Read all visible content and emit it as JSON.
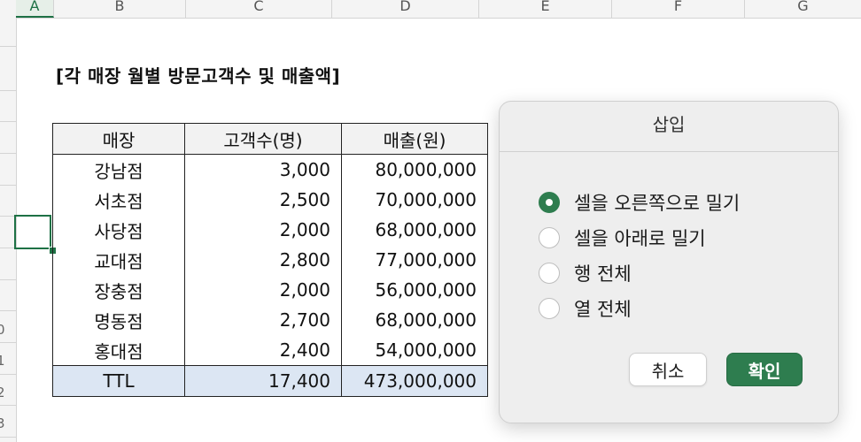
{
  "columns": [
    "A",
    "B",
    "C",
    "D",
    "E",
    "F",
    "G"
  ],
  "row_numbers": [
    "0",
    "1",
    "2",
    "3"
  ],
  "sheet": {
    "title": "[각 매장 월별 방문고객수 및 매출액]",
    "table": {
      "headers": [
        "매장",
        "고객수(명)",
        "매출(원)"
      ],
      "rows": [
        [
          "강남점",
          "3,000",
          "80,000,000"
        ],
        [
          "서초점",
          "2,500",
          "70,000,000"
        ],
        [
          "사당점",
          "2,000",
          "68,000,000"
        ],
        [
          "교대점",
          "2,800",
          "77,000,000"
        ],
        [
          "장충점",
          "2,000",
          "56,000,000"
        ],
        [
          "명동점",
          "2,700",
          "68,000,000"
        ],
        [
          "홍대점",
          "2,400",
          "54,000,000"
        ]
      ],
      "total": [
        "TTL",
        "17,400",
        "473,000,000"
      ]
    }
  },
  "dialog": {
    "title": "삽입",
    "options": [
      {
        "label": "셀을 오른쪽으로 밀기",
        "selected": true
      },
      {
        "label": "셀을 아래로 밀기",
        "selected": false
      },
      {
        "label": "행 전체",
        "selected": false
      },
      {
        "label": "열 전체",
        "selected": false
      }
    ],
    "cancel_label": "취소",
    "ok_label": "확인"
  },
  "colors": {
    "accent": "#2e7d4f",
    "total_row_bg": "#dce6f3",
    "header_bg": "#f2f2f2"
  }
}
